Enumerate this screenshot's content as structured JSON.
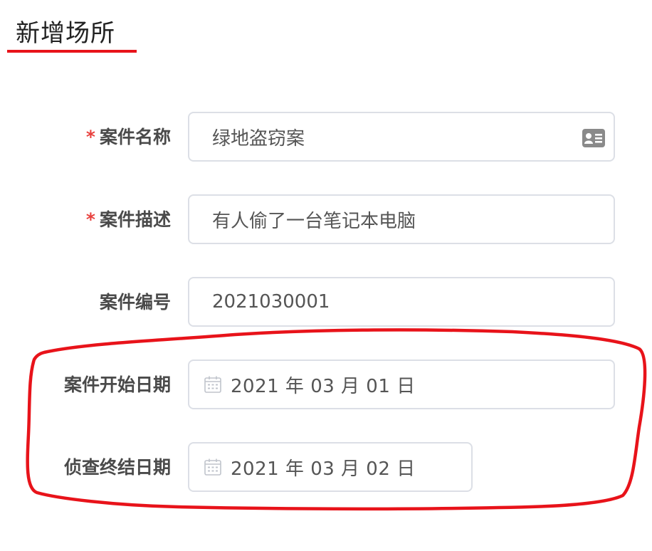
{
  "page": {
    "title": "新增场所"
  },
  "form": {
    "case_name": {
      "required_mark": "*",
      "label": "案件名称",
      "value": "绿地盗窃案",
      "icon": "id-card-icon"
    },
    "case_description": {
      "required_mark": "*",
      "label": "案件描述",
      "value": "有人偷了一台笔记本电脑"
    },
    "case_number": {
      "label": "案件编号",
      "value": "2021030001"
    },
    "case_start_date": {
      "label": "案件开始日期",
      "value": "2021 年 03 月 01 日",
      "icon": "calendar-icon"
    },
    "investigation_end_date": {
      "label": "侦查终结日期",
      "value": "2021 年 03 月 02 日",
      "icon": "calendar-icon"
    }
  },
  "colors": {
    "accent_red": "#e8131a",
    "required_star": "#e8413e",
    "field_border": "#dcdfe6",
    "label_text": "#4a4a4a",
    "value_text": "#555555"
  }
}
